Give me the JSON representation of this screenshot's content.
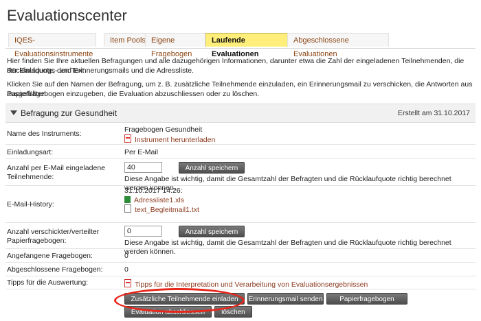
{
  "page_title": "Evaluationscenter",
  "tabs": [
    {
      "label": "IQES-Evaluationsinstrumente"
    },
    {
      "label": "Item Pools"
    },
    {
      "label": "Eigene Fragebogen"
    },
    {
      "label": "Laufende Evaluationen"
    },
    {
      "label": "Abgeschlossene Evaluationen"
    }
  ],
  "intro": {
    "line1": "Hier finden Sie Ihre aktuellen Befragungen und alle dazugehörigen Informationen, darunter etwa die Zahl der eingeladenen Teilnehmenden, die Rücklaufquote, den Text",
    "line2": "der Einladungs- und Erinnerungsmails und die Adressliste.",
    "line3": "Klicken Sie auf den Namen der Befragung, um z. B. zusätzliche Teilnehmende einzuladen, ein Erinnerungsmail zu verschicken, die Antworten aus ausgefüllten",
    "line4": "Papierfragebogen einzugeben, die Evaluation abzuschliessen oder zu löschen."
  },
  "survey": {
    "title": "Befragung zur Gesundheit",
    "created": "Erstellt am 31.10.2017",
    "instrument_label": "Name des Instruments:",
    "instrument_name": "Fragebogen Gesundheit",
    "instrument_download": "Instrument herunterladen",
    "invite_type_label": "Einladungsart:",
    "invite_type": "Per E-Mail",
    "email_count_label_1": "Anzahl per E-Mail eingeladene",
    "email_count_label_2": "Teilnehmende:",
    "email_count_value": "40",
    "save_count_button": "Anzahl speichern",
    "count_note": "Diese Angabe ist wichtig, damit die Gesamtzahl der Befragten und die Rücklaufquote richtig berechnet werden können.",
    "history_label": "E-Mail-History:",
    "history_date": "31.10.2017 14:26:",
    "history_file1": "Adressliste1.xls",
    "history_file2": "text_Begleitmail1.txt",
    "paper_count_label_1": "Anzahl verschickter/verteilter",
    "paper_count_label_2": "Papierfragebogen:",
    "paper_count_value": "0",
    "save_paper_button": "Anzahl speichern",
    "paper_note": "Diese Angabe ist wichtig, damit die Gesamtzahl der Befragten und die Rücklaufquote richtig berechnet werden können.",
    "started_label": "Angefangene Fragebogen:",
    "started_value": "0",
    "completed_label": "Abgeschlossene Fragebogen:",
    "completed_value": "0",
    "tips_label": "Tipps für die Auswertung:",
    "tips_link": "Tipps für die Interpretation und Verarbeitung von Evaluationsergebnissen"
  },
  "actions": {
    "invite_more": "Zusätzliche Teilnehmende einladen",
    "reminder": "Erinnerungsmail senden",
    "paper_entry": "Papierfragebogen eingeben",
    "finish": "Evaluation abschliessen",
    "delete": "löschen"
  },
  "colors": {
    "active_tab": "#ffef7a",
    "link": "#8b3a1e",
    "highlight_circle": "#e8251a"
  }
}
